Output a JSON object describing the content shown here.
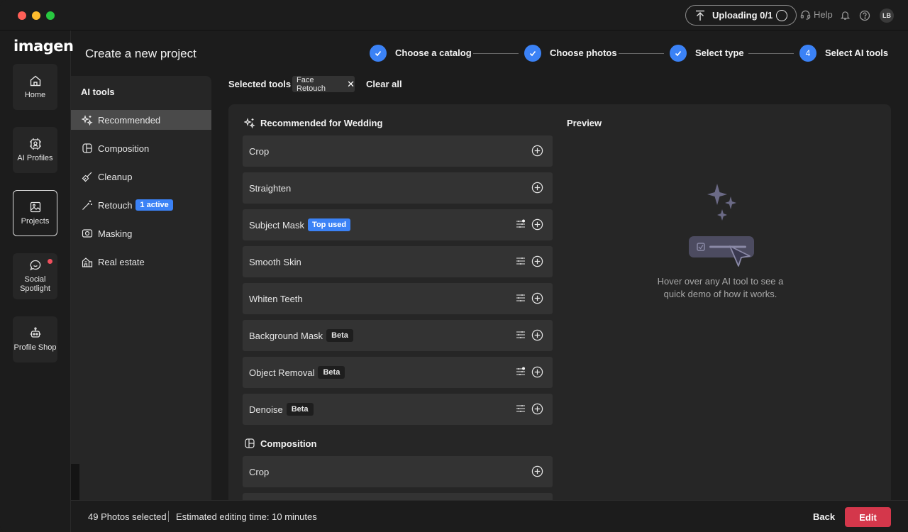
{
  "colors": {
    "accent": "#3b82f6",
    "edit_button": "#d4374b",
    "notification_dot": "#f04f5d"
  },
  "titlebar": {
    "upload_label": "Uploading 0/1",
    "help_label": "Help",
    "avatar_initials": "LB"
  },
  "nav": {
    "logo": "imagen",
    "items": [
      {
        "label": "Home",
        "icon": "house-icon"
      },
      {
        "label": "AI Profiles",
        "icon": "ai-chip-icon"
      },
      {
        "label": "Projects",
        "icon": "image-icon",
        "active": true
      },
      {
        "label": "Social Spotlight",
        "icon": "chat-bubble-icon",
        "notification": true
      },
      {
        "label": "Profile Shop",
        "icon": "shop-icon"
      }
    ]
  },
  "header": {
    "title": "Create a new project",
    "steps": [
      {
        "label": "Choose a catalog",
        "state": "done"
      },
      {
        "label": "Choose photos",
        "state": "done"
      },
      {
        "label": "Select type",
        "state": "done"
      },
      {
        "label": "Select AI tools",
        "state": "current",
        "number": "4"
      }
    ]
  },
  "tools_panel": {
    "title": "AI tools",
    "categories": [
      {
        "label": "Recommended",
        "icon": "sparkle-icon",
        "active": true
      },
      {
        "label": "Composition",
        "icon": "composition-icon"
      },
      {
        "label": "Cleanup",
        "icon": "brush-icon"
      },
      {
        "label": "Retouch",
        "icon": "wand-icon",
        "badge": "1 active"
      },
      {
        "label": "Masking",
        "icon": "mask-icon"
      },
      {
        "label": "Real estate",
        "icon": "building-icon"
      }
    ]
  },
  "selected": {
    "label": "Selected tools",
    "chip": "Face Retouch",
    "clear_all": "Clear all"
  },
  "main": {
    "recommended_heading": "Recommended for Wedding",
    "recommended_tools": [
      {
        "label": "Crop",
        "adjustable": false
      },
      {
        "label": "Straighten",
        "adjustable": false
      },
      {
        "label": "Subject Mask",
        "tag": "Top used",
        "tag_type": "top",
        "adjustable": true,
        "adjust_dot": true
      },
      {
        "label": "Smooth Skin",
        "adjustable": true
      },
      {
        "label": "Whiten Teeth",
        "adjustable": true
      },
      {
        "label": "Background Mask",
        "tag": "Beta",
        "tag_type": "beta",
        "adjustable": true
      },
      {
        "label": "Object Removal",
        "tag": "Beta",
        "tag_type": "beta",
        "adjustable": true,
        "adjust_dot": true
      },
      {
        "label": "Denoise",
        "tag": "Beta",
        "tag_type": "beta",
        "adjustable": true
      }
    ],
    "composition_heading": "Composition",
    "composition_tools": [
      {
        "label": "Crop",
        "adjustable": false
      }
    ],
    "preview_title": "Preview",
    "preview_text": "Hover over any AI tool to see a quick demo of how it works."
  },
  "footer": {
    "photos": "49 Photos selected",
    "time": "Estimated editing time: 10 minutes",
    "back": "Back",
    "edit": "Edit"
  }
}
